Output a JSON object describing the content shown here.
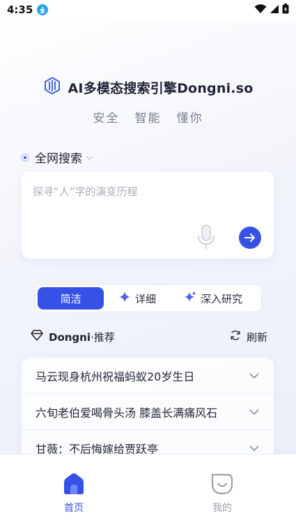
{
  "status_bar": {
    "time": "4:35"
  },
  "brand": {
    "title": "AI多模态搜索引擎Dongni.so"
  },
  "tagline": [
    "安全",
    "智能",
    "懂你"
  ],
  "search_scope": {
    "label": "全网搜索"
  },
  "search": {
    "placeholder": "探寻“人”字的演变历程"
  },
  "modes": [
    {
      "label": "简洁",
      "active": true
    },
    {
      "label": "详细",
      "active": false
    },
    {
      "label": "深入研究",
      "active": false
    }
  ],
  "recommend": {
    "brand": "Dongni",
    "suffix": "·推荐",
    "refresh_label": "刷新"
  },
  "news": [
    {
      "text": "马云现身杭州祝福蚂蚁20岁生日"
    },
    {
      "text": "六旬老伯爱喝骨头汤 膝盖长满痛风石"
    },
    {
      "text": "甘薇：不后悔嫁给贾跃亭"
    }
  ],
  "bottom_nav": [
    {
      "label": "首页",
      "icon": "home-icon",
      "active": true
    },
    {
      "label": "我的",
      "icon": "smile-icon",
      "active": false
    }
  ],
  "colors": {
    "accent": "#3652e6",
    "text": "#1e2130",
    "muted": "#7a7f8f"
  }
}
